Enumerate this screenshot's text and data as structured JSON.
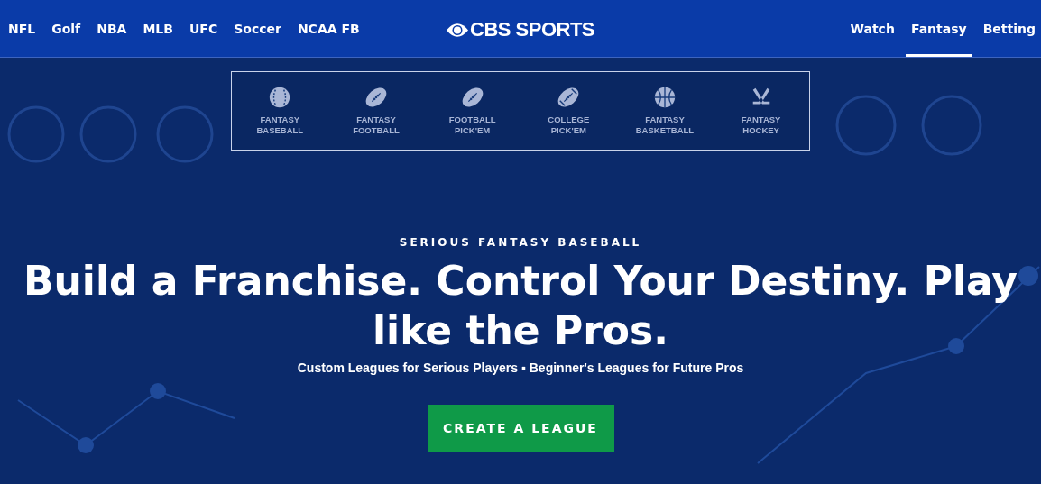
{
  "nav": {
    "left_links": [
      "NFL",
      "Golf",
      "NBA",
      "MLB",
      "UFC",
      "Soccer",
      "NCAA FB"
    ],
    "logo": "CBS SPORTS",
    "right_tabs": [
      {
        "label": "Watch",
        "selected": false
      },
      {
        "label": "Fantasy",
        "selected": true
      },
      {
        "label": "Betting",
        "selected": false
      }
    ]
  },
  "products": [
    {
      "kind": "baseball",
      "label": "FANTASY BASEBALL"
    },
    {
      "kind": "football",
      "label": "FANTASY FOOTBALL"
    },
    {
      "kind": "football",
      "label": "FOOTBALL PICK'EM"
    },
    {
      "kind": "college-football",
      "label": "COLLEGE PICK'EM"
    },
    {
      "kind": "basketball",
      "label": "FANTASY BASKETBALL"
    },
    {
      "kind": "hockey",
      "label": "FANTASY HOCKEY"
    }
  ],
  "hero": {
    "eyebrow": "SERIOUS FANTASY BASEBALL",
    "headline": "Build a Franchise. Control Your Destiny. Play like the Pros.",
    "subtitle": "Custom Leagues for Serious Players ▪ Beginner's Leagues for Future Pros",
    "cta": "CREATE A LEAGUE"
  }
}
